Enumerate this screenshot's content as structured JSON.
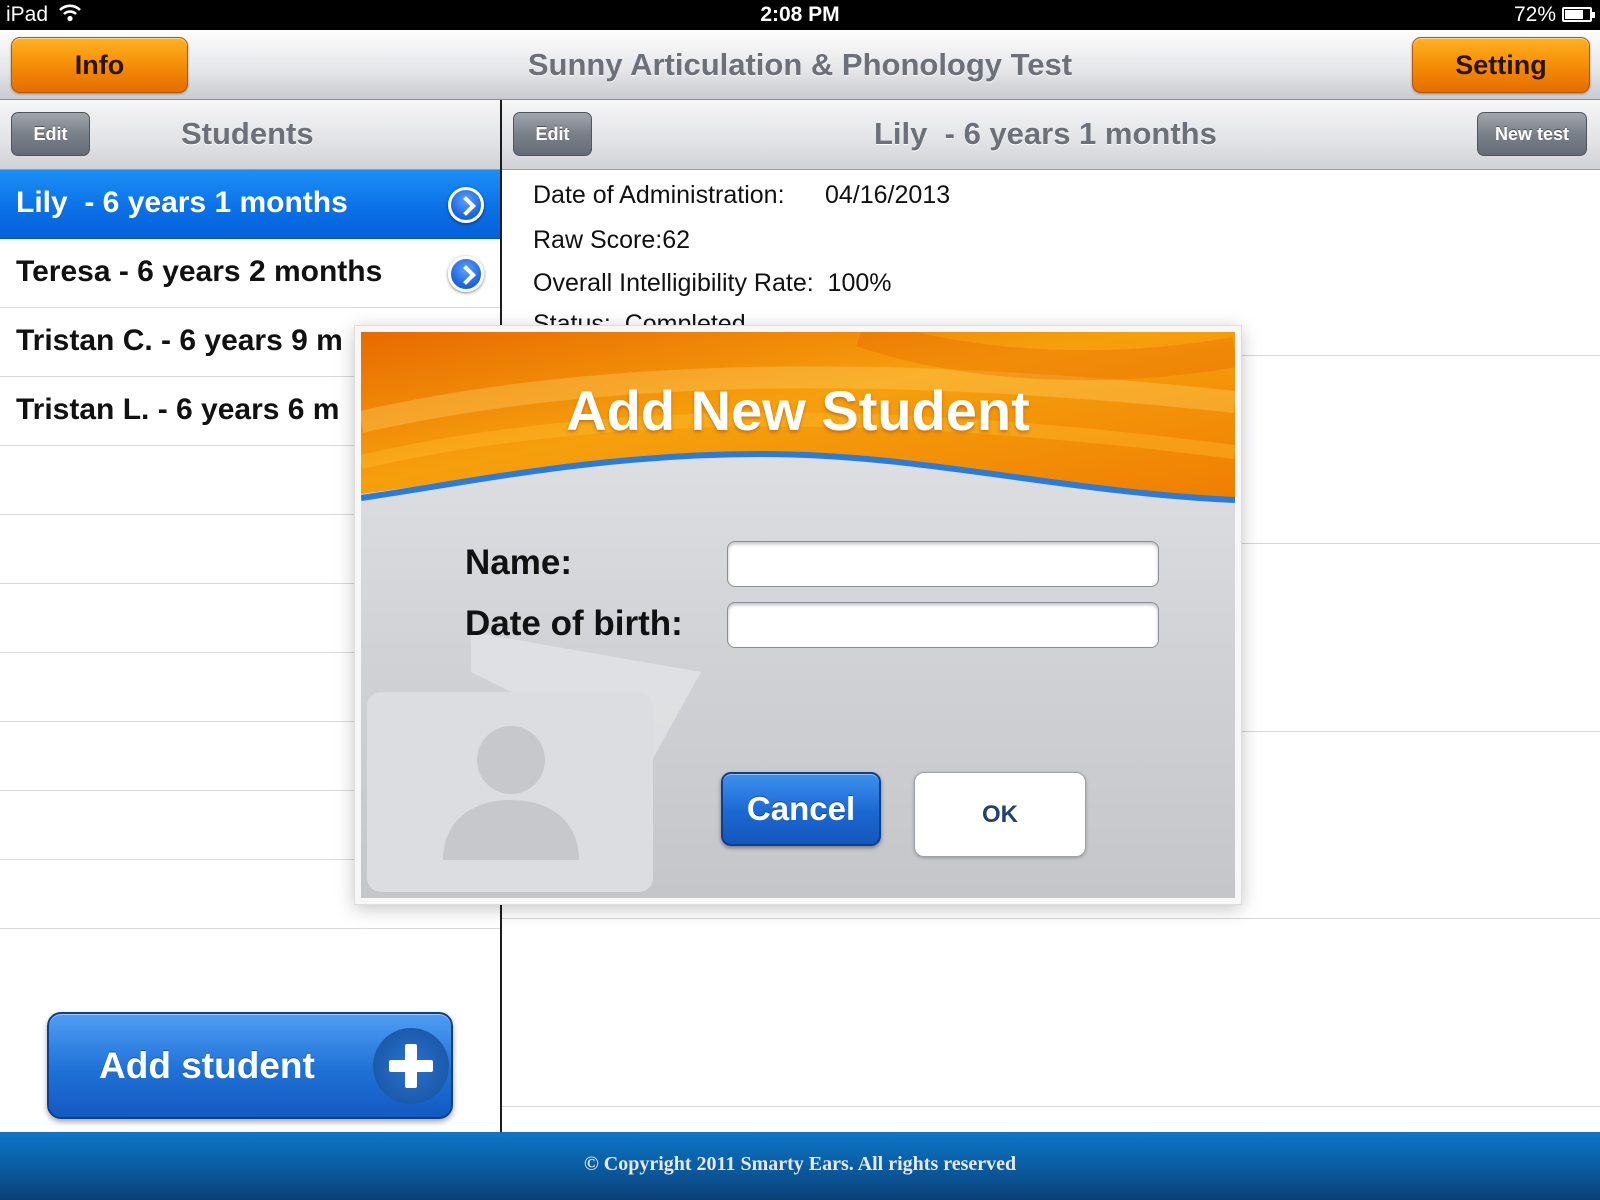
{
  "status_bar": {
    "device": "iPad",
    "time": "2:08 PM",
    "battery": "72%"
  },
  "top_bar": {
    "title": "Sunny Articulation & Phonology Test",
    "info_label": "Info",
    "setting_label": "Setting"
  },
  "students_panel": {
    "edit_label": "Edit",
    "title": "Students",
    "items": [
      {
        "label": "Lily  - 6 years 1 months"
      },
      {
        "label": "Teresa - 6 years 2 months"
      },
      {
        "label": "Tristan C. - 6 years 9 m"
      },
      {
        "label": "Tristan L. - 6 years 6 m"
      }
    ],
    "add_label": "Add student"
  },
  "detail_panel": {
    "edit_label": "Edit",
    "title": "Lily  - 6 years 1 months",
    "new_test_label": "New test",
    "date_of_administration_label": "Date of Administration:",
    "date_of_administration_value": "04/16/2013",
    "raw_score": "Raw Score:62",
    "intelligibility": "Overall Intelligibility Rate:  100%",
    "status": "Status:  Completed"
  },
  "modal": {
    "title": "Add New Student",
    "name_label": "Name:",
    "name_value": "",
    "dob_label": "Date of birth:",
    "dob_value": "",
    "cancel_label": "Cancel",
    "ok_label": "OK"
  },
  "footer": {
    "copyright": "© Copyright 2011 Smarty Ears. All rights reserved"
  },
  "colors": {
    "accent_orange": "#f48a06",
    "selection_blue": "#0a6fe6",
    "footer_blue": "#0a5da3"
  }
}
